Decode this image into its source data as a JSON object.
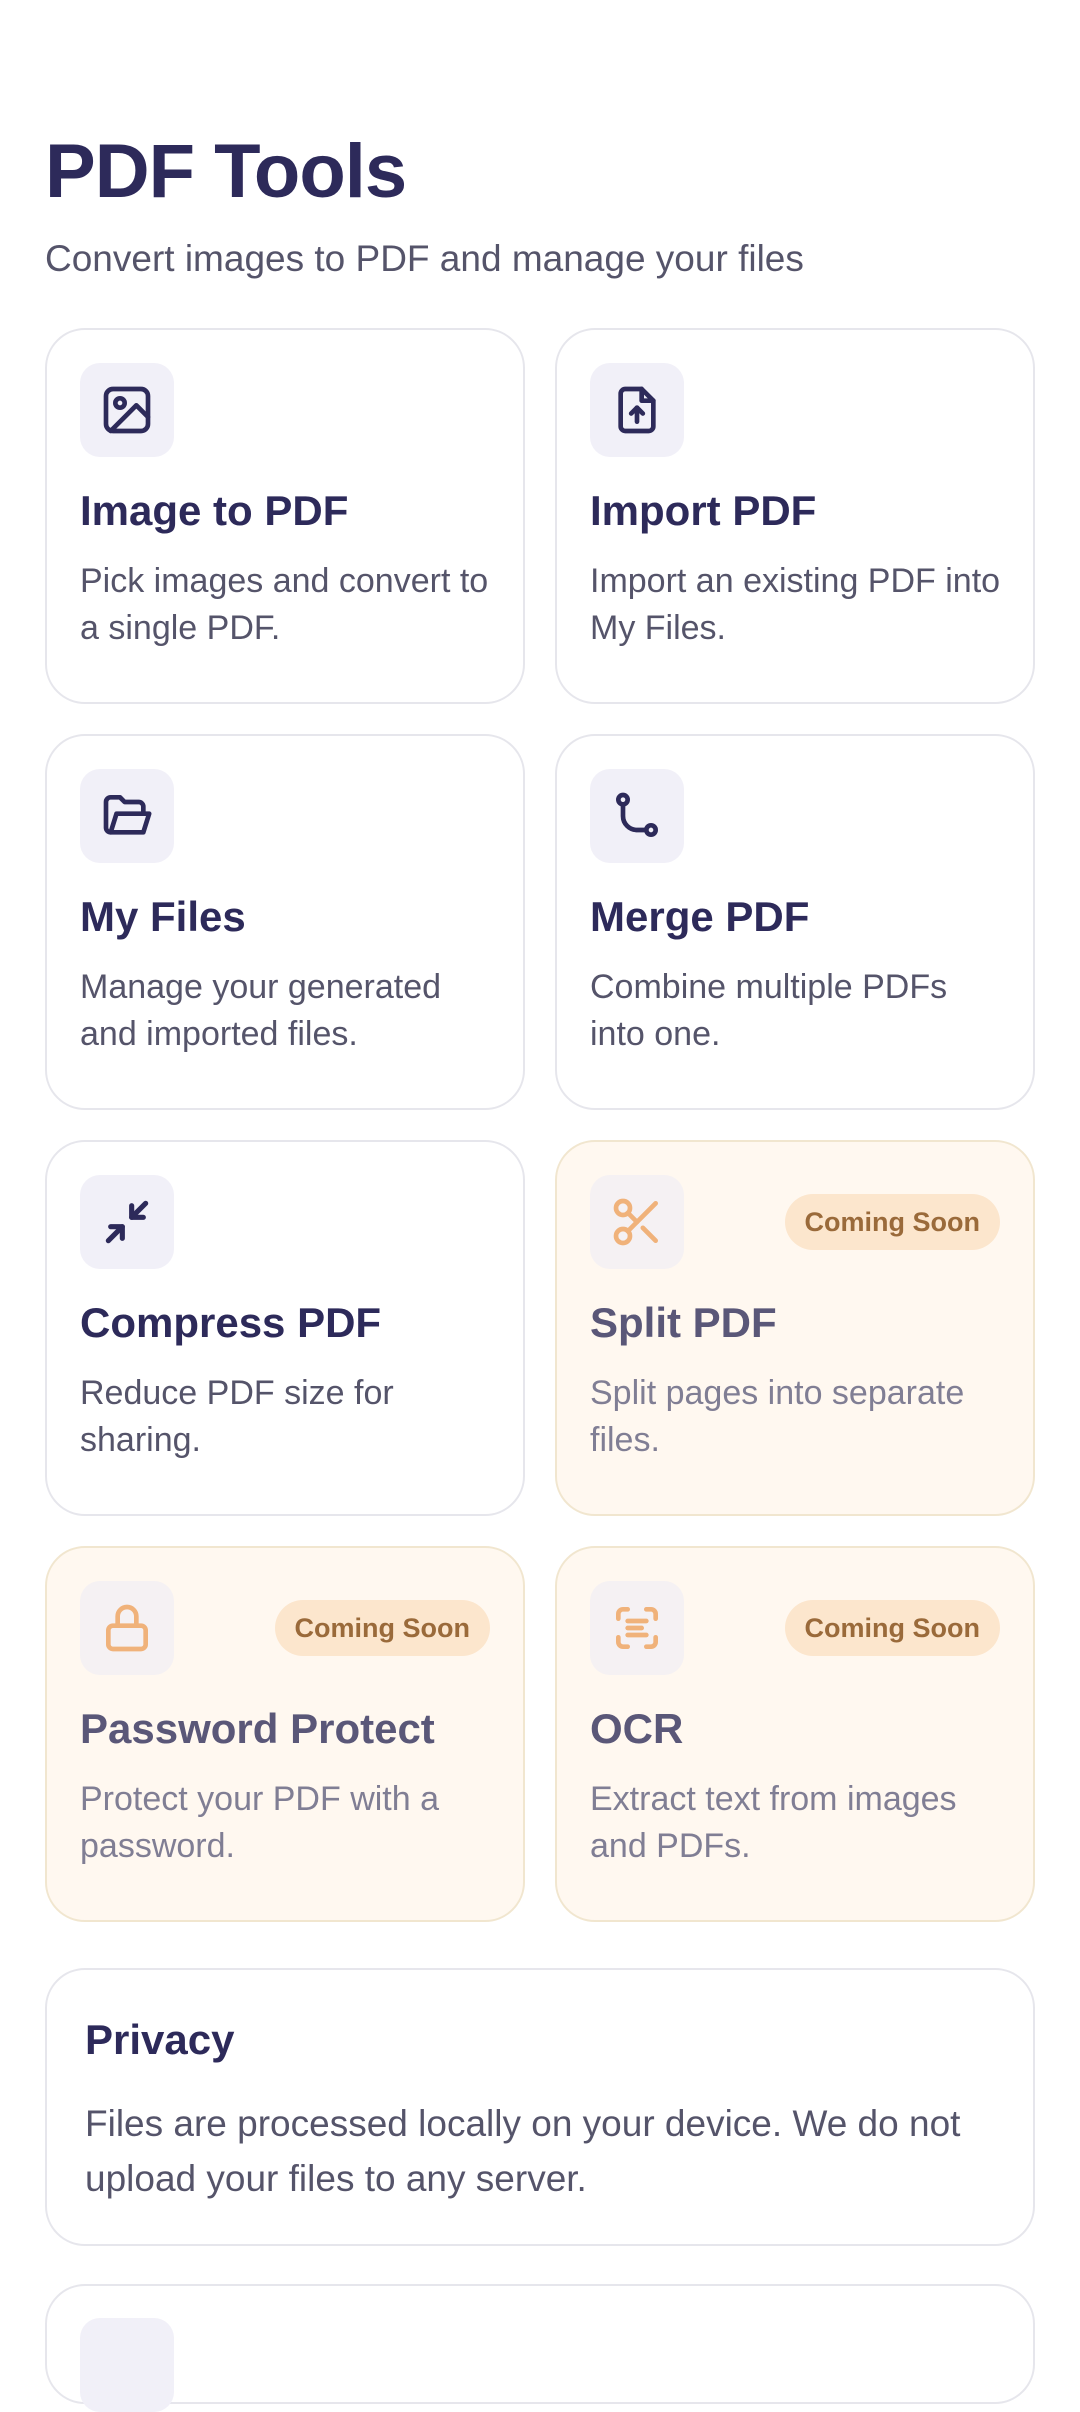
{
  "header": {
    "title": "PDF Tools",
    "subtitle": "Convert images to PDF and manage your files"
  },
  "tools": [
    {
      "title": "Image to PDF",
      "description": "Pick images and convert to a single PDF.",
      "icon": "image-icon",
      "coming_soon": false
    },
    {
      "title": "Import PDF",
      "description": "Import an existing PDF into My Files.",
      "icon": "file-upload-icon",
      "coming_soon": false
    },
    {
      "title": "My Files",
      "description": "Manage your generated and imported files.",
      "icon": "folder-open-icon",
      "coming_soon": false
    },
    {
      "title": "Merge PDF",
      "description": "Combine multiple PDFs into one.",
      "icon": "merge-route-icon",
      "coming_soon": false
    },
    {
      "title": "Compress PDF",
      "description": "Reduce PDF size for sharing.",
      "icon": "compress-arrows-icon",
      "coming_soon": false
    },
    {
      "title": "Split PDF",
      "description": "Split pages into separate files.",
      "icon": "scissors-icon",
      "coming_soon": true,
      "badge": "Coming Soon"
    },
    {
      "title": "Password Protect",
      "description": "Protect your PDF with a password.",
      "icon": "lock-icon",
      "coming_soon": true,
      "badge": "Coming Soon"
    },
    {
      "title": "OCR",
      "description": "Extract text from images and PDFs.",
      "icon": "scan-text-icon",
      "coming_soon": true,
      "badge": "Coming Soon"
    }
  ],
  "privacy": {
    "title": "Privacy",
    "text": "Files are processed locally on your device. We do not upload your files to any server."
  },
  "colors": {
    "primary": "#2d2a5a",
    "badge_bg": "#fce6cd",
    "badge_text": "#9a6a3a",
    "soon_icon": "#f0b27a"
  }
}
